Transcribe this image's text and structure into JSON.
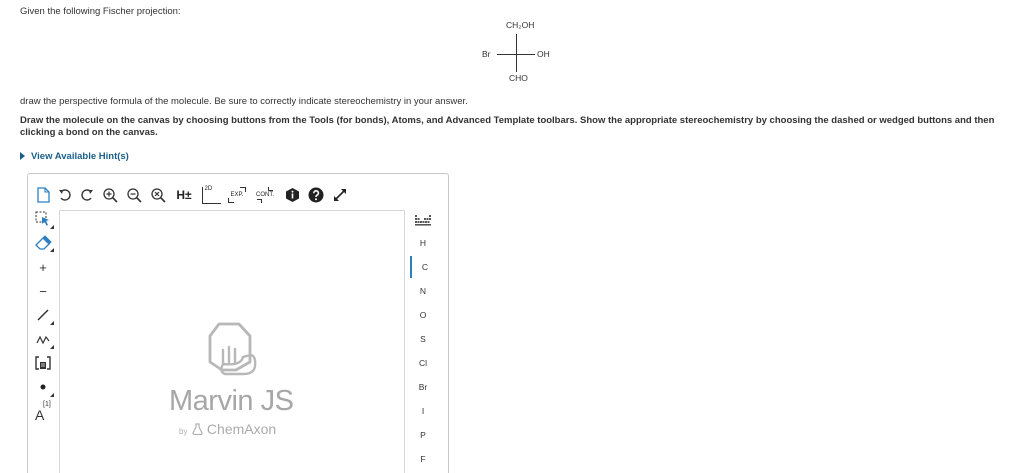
{
  "question": {
    "intro": "Given the following Fischer projection:",
    "fischer": {
      "top": "CH₂OH",
      "left": "Br",
      "right": "OH",
      "bottom": "CHO"
    },
    "draw_prompt": "draw the perspective formula of the molecule. Be sure to correctly indicate stereochemistry in your answer.",
    "instructions": "Draw the molecule on the canvas by choosing buttons from the Tools (for bonds), Atoms, and Advanced Template toolbars. Show the appropriate stereochemistry by choosing the dashed or wedged buttons and then clicking a bond on the canvas.",
    "hint_link": "View Available Hint(s)"
  },
  "editor": {
    "top_toolbar": {
      "explicit_h_label": "H±",
      "clean2d_label": "2D",
      "expand_label": "EXP.",
      "contract_label": "CONT."
    },
    "left_toolbar": {
      "atom_label_tool": "A",
      "atom_label_superscript": "[1]"
    },
    "atoms": [
      "H",
      "C",
      "N",
      "O",
      "S",
      "Cl",
      "Br",
      "I",
      "P",
      "F"
    ],
    "selected_atom": "C",
    "logo": {
      "name": "Marvin JS",
      "by": "by",
      "company": "ChemAxon"
    }
  },
  "colors": {
    "hint_link": "#1a5e8a",
    "selected_atom_marker": "#2d7fc1",
    "logo_gray": "#a7a7a7",
    "delete_icon_blue": "#2d7fc1"
  }
}
